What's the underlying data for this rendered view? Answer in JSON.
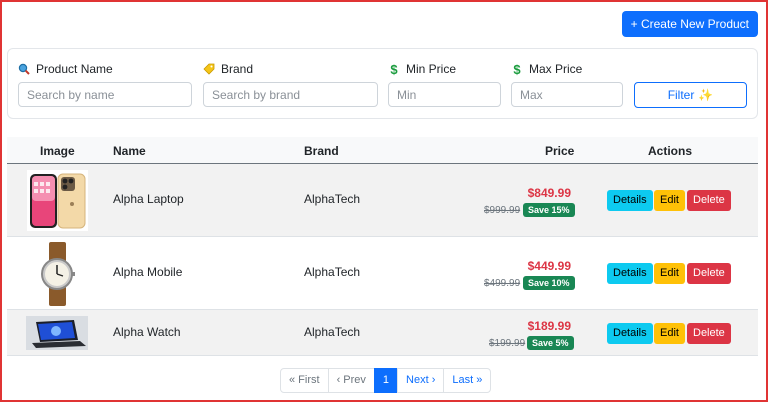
{
  "header": {
    "create_label": "+ Create New Product"
  },
  "filters": {
    "product_name": {
      "label": "Product Name",
      "placeholder": "Search by name"
    },
    "brand": {
      "label": "Brand",
      "placeholder": "Search by brand"
    },
    "min_price": {
      "label": "Min Price",
      "placeholder": "Min"
    },
    "max_price": {
      "label": "Max Price",
      "placeholder": "Max"
    },
    "filter_label": "Filter",
    "filter_emoji": "✨"
  },
  "table": {
    "columns": [
      "Image",
      "Name",
      "Brand",
      "Price",
      "Actions"
    ],
    "rows": [
      {
        "name": "Alpha Laptop",
        "brand": "AlphaTech",
        "price": "$849.99",
        "old_price": "$999.99",
        "save": "Save 15%",
        "image": "iphone-image"
      },
      {
        "name": "Alpha Mobile",
        "brand": "AlphaTech",
        "price": "$449.99",
        "old_price": "$499.99",
        "save": "Save 10%",
        "image": "watch-image"
      },
      {
        "name": "Alpha Watch",
        "brand": "AlphaTech",
        "price": "$189.99",
        "old_price": "$199.99",
        "save": "Save 5%",
        "image": "laptop-image"
      }
    ],
    "actions": {
      "details": "Details",
      "edit": "Edit",
      "delete": "Delete"
    }
  },
  "pagination": {
    "first": "« First",
    "prev": "‹ Prev",
    "current": "1",
    "next": "Next ›",
    "last": "Last »"
  },
  "colors": {
    "primary": "#0d6efd",
    "danger": "#dc3545",
    "success": "#198754",
    "info": "#0dcaf0",
    "warning": "#ffc107"
  }
}
